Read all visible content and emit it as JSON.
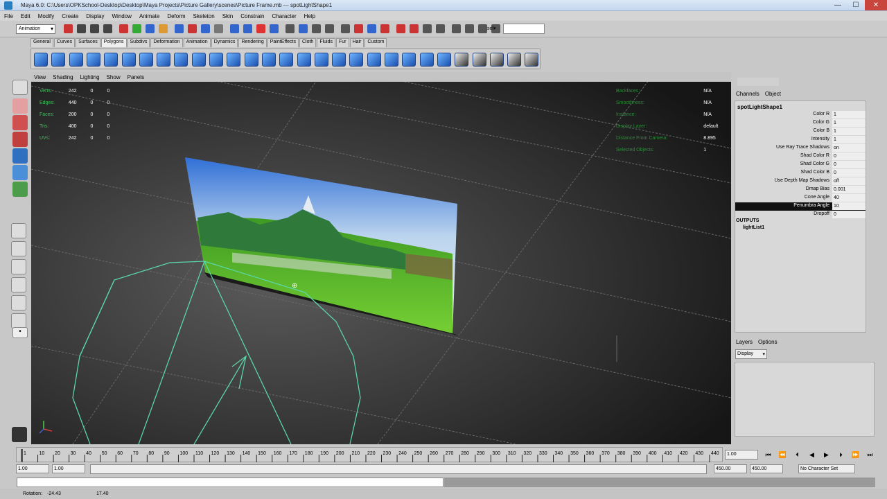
{
  "window": {
    "title": "Maya 6.0: C:\\Users\\OPKSchool-Desktop\\Desktop\\Maya Projects\\Picture Gallery\\scenes\\Picture Frame.mb   ---   spotLightShape1",
    "minimize": "—",
    "maximize": "☐",
    "close": "✕"
  },
  "menubar": [
    "File",
    "Edit",
    "Modify",
    "Create",
    "Display",
    "Window",
    "Animate",
    "Deform",
    "Skeleton",
    "Skin",
    "Constrain",
    "Character",
    "Help"
  ],
  "statusline": {
    "mode": "Animation",
    "sel_label": "sel▾"
  },
  "shelf_tabs": [
    "General",
    "Curves",
    "Surfaces",
    "Polygons",
    "Subdivs",
    "Deformation",
    "Animation",
    "Dynamics",
    "Rendering",
    "PaintEffects",
    "Cloth",
    "Fluids",
    "Fur",
    "Hair",
    "Custom"
  ],
  "shelf_active": "Polygons",
  "viewport": {
    "menu": [
      "View",
      "Shading",
      "Lighting",
      "Show",
      "Panels"
    ],
    "hud_left": [
      {
        "label": "Verts:",
        "a": "242",
        "b": "0",
        "c": "0"
      },
      {
        "label": "Edges:",
        "a": "440",
        "b": "0",
        "c": "0"
      },
      {
        "label": "Faces:",
        "a": "200",
        "b": "0",
        "c": "0"
      },
      {
        "label": "Tris:",
        "a": "400",
        "b": "0",
        "c": "0"
      },
      {
        "label": "UVs:",
        "a": "242",
        "b": "0",
        "c": "0"
      }
    ],
    "hud_right": [
      {
        "label": "Backfaces:",
        "value": "N/A"
      },
      {
        "label": "Smoothness:",
        "value": "N/A"
      },
      {
        "label": "Instance:",
        "value": "N/A"
      },
      {
        "label": "Display Layer:",
        "value": "default"
      },
      {
        "label": "Distance From Camera:",
        "value": "8.895"
      },
      {
        "label": "Selected Objects:",
        "value": "1"
      }
    ],
    "colors": {
      "background": "#222222",
      "wireframe": "#5ad6a8",
      "grid": "#6a6a6a"
    }
  },
  "channelbox": {
    "tabs": [
      "Channels",
      "Object"
    ],
    "node": "spotLightShape1",
    "rows": [
      {
        "label": "Color R",
        "value": "1"
      },
      {
        "label": "Color G",
        "value": "1"
      },
      {
        "label": "Color B",
        "value": "1"
      },
      {
        "label": "Intensity",
        "value": "1"
      },
      {
        "label": "Use Ray Trace Shadows",
        "value": "on"
      },
      {
        "label": "Shad Color R",
        "value": "0"
      },
      {
        "label": "Shad Color G",
        "value": "0"
      },
      {
        "label": "Shad Color B",
        "value": "0"
      },
      {
        "label": "Use Depth Map Shadows",
        "value": "off"
      },
      {
        "label": "Dmap Bias",
        "value": "0.001"
      },
      {
        "label": "Cone Angle",
        "value": "40"
      },
      {
        "label": "Penumbra Angle",
        "value": "10"
      },
      {
        "label": "Dropoff",
        "value": "0"
      }
    ],
    "selected_row": "Penumbra Angle",
    "outputs_title": "OUTPUTS",
    "outputs": [
      "lightList1"
    ]
  },
  "layers": {
    "tabs": [
      "Layers",
      "Options"
    ],
    "display": "Display"
  },
  "timeline": {
    "ticks": [
      "1",
      "10",
      "20",
      "30",
      "40",
      "50",
      "60",
      "70",
      "80",
      "90",
      "100",
      "110",
      "120",
      "130",
      "140",
      "150",
      "160",
      "170",
      "180",
      "190",
      "200",
      "210",
      "220",
      "230",
      "240",
      "250",
      "260",
      "270",
      "280",
      "290",
      "300",
      "310",
      "320",
      "330",
      "340",
      "350",
      "360",
      "370",
      "380",
      "390",
      "400",
      "410",
      "420",
      "430",
      "440"
    ],
    "current_time": "1.00",
    "playback": [
      "⏮",
      "⏪",
      "⏴",
      "◀",
      "▶",
      "⏵",
      "⏩",
      "⏭"
    ]
  },
  "range": {
    "start": "1.00",
    "start2": "1.00",
    "end": "450.00",
    "end2": "450.00",
    "character_set": "No Character Set"
  },
  "helpline": {
    "rotation_label": "Rotation:",
    "rotation_x": "-24.43",
    "rotation_y": "17.40"
  }
}
